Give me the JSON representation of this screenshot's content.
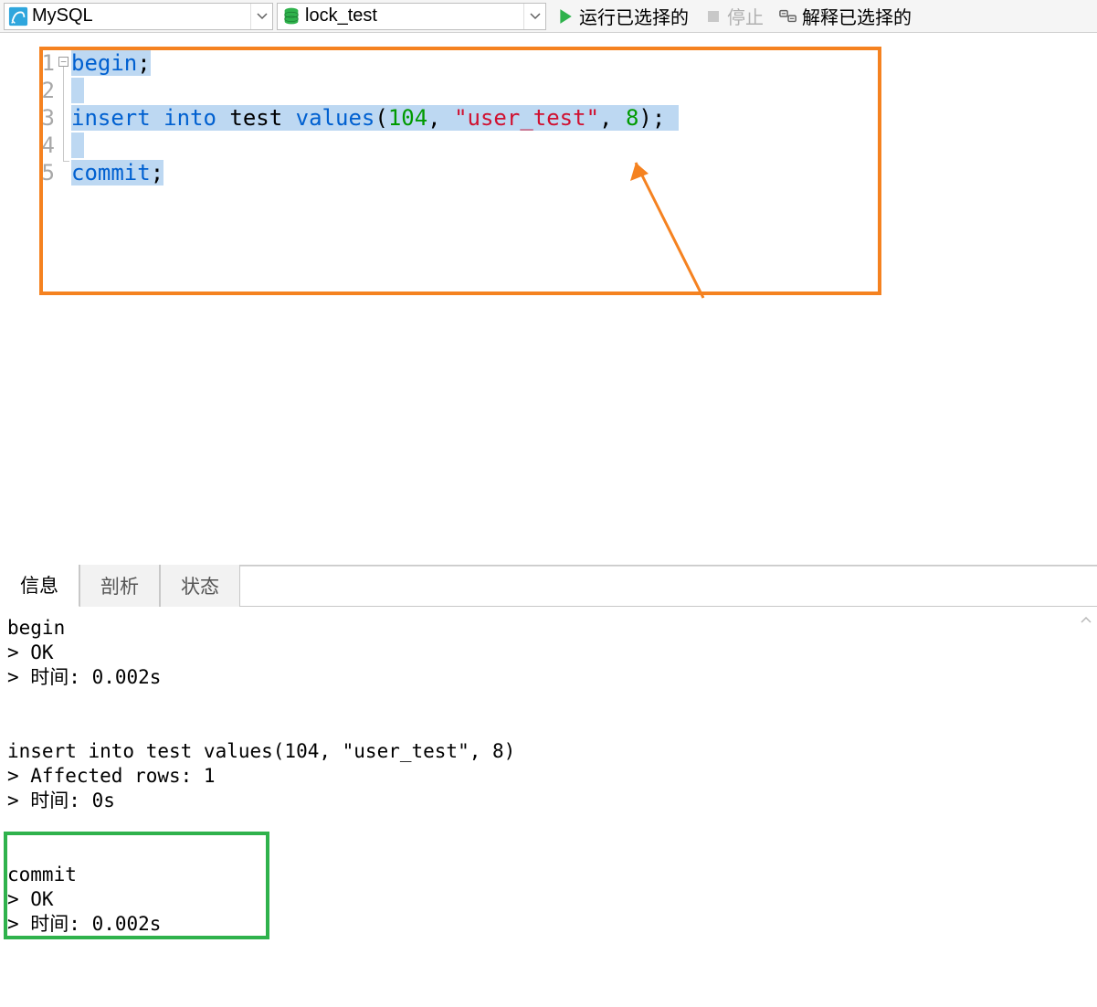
{
  "toolbar": {
    "conn_label": "MySQL",
    "db_label": "lock_test",
    "run_label": "运行已选择的",
    "stop_label": "停止",
    "explain_label": "解释已选择的"
  },
  "editor": {
    "line_numbers": [
      "1",
      "2",
      "3",
      "4",
      "5"
    ],
    "code": {
      "l1_begin": "begin",
      "l1_semi": ";",
      "l3_insert": "insert",
      "l3_into": "into",
      "l3_test": "test",
      "l3_values": "values",
      "l3_lpar": "(",
      "l3_104": "104",
      "l3_c1": ", ",
      "l3_str": "\"user_test\"",
      "l3_c2": ", ",
      "l3_8": "8",
      "l3_rpar": ")",
      "l3_semi": ";",
      "l5_commit": "commit",
      "l5_semi": ";"
    }
  },
  "tabs": {
    "info": "信息",
    "profile": "剖析",
    "status": "状态"
  },
  "output": "begin\n> OK\n> 时间: 0.002s\n\n\ninsert into test values(104, \"user_test\", 8)\n> Affected rows: 1\n> 时间: 0s\n\n\ncommit\n> OK\n> 时间: 0.002s"
}
